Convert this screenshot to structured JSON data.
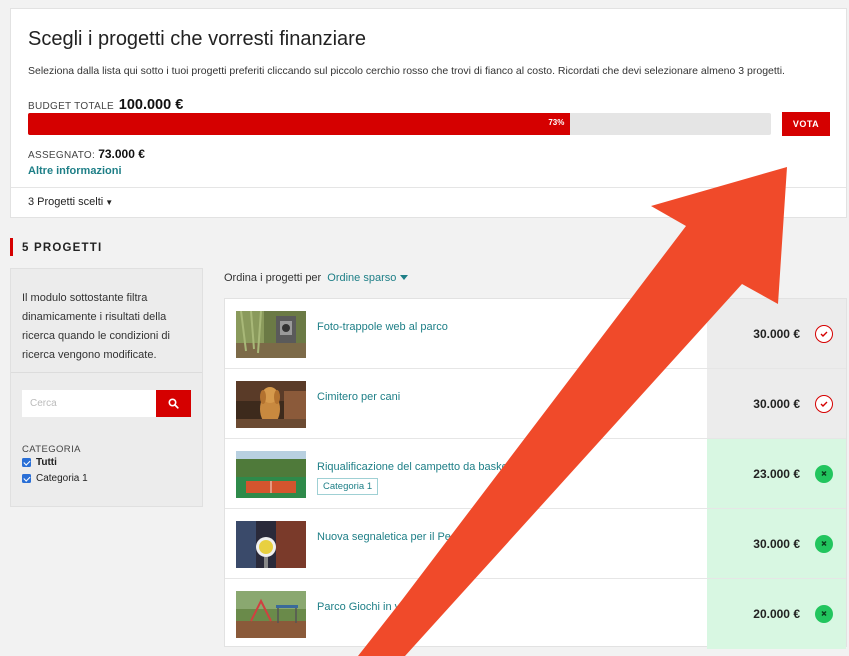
{
  "header": {
    "title": "Scegli i progetti che vorresti finanziare",
    "description": "Seleziona dalla lista qui sotto i tuoi progetti preferiti cliccando sul piccolo cerchio rosso che trovi di fianco al costo. Ricordati che devi selezionare almeno 3 progetti.",
    "budget_label": "Budget totale",
    "budget_value": "100.000 €",
    "progress_label": "73%",
    "progress_fraction": 0.73,
    "vote_button": "VOTA",
    "assigned_label": "Assegnato:",
    "assigned_value": "73.000 €",
    "more_info": "Altre informazioni",
    "chosen_count": "3 Progetti scelti"
  },
  "section": {
    "title": "5 PROGETTI"
  },
  "filter": {
    "description": "Il modulo sottostante filtra dinamicamente i risultati della ricerca quando le condizioni di ricerca vengono modificate.",
    "search_placeholder": "Cerca",
    "category_label": "CATEGORIA",
    "options": [
      "Tutti",
      "Categoria 1"
    ]
  },
  "sort": {
    "label": "Ordina i progetti per",
    "value": "Ordine sparso"
  },
  "projects": [
    {
      "title": "Foto-trappole web al parco",
      "tag": "",
      "cost": "30.000 €",
      "selected": false,
      "thumb": "forest-camera"
    },
    {
      "title": "Cimitero per cani",
      "tag": "",
      "cost": "30.000 €",
      "selected": false,
      "thumb": "dog"
    },
    {
      "title": "Riqualificazione del campetto da basket in via",
      "tag": "Categoria 1",
      "cost": "23.000 €",
      "selected": true,
      "thumb": "basket-court"
    },
    {
      "title": "Nuova segnaletica per il Pedibus",
      "tag": "",
      "cost": "30.000 €",
      "selected": true,
      "thumb": "street-sign"
    },
    {
      "title": "Parco Giochi in via Albero",
      "tag": "",
      "cost": "20.000 €",
      "selected": true,
      "thumb": "playground"
    }
  ],
  "colors": {
    "accent": "#d50000",
    "link": "#1e7f87",
    "selected_bg": "#d8f7e2",
    "selected_icon": "#22c55e",
    "arrow": "#f04a2a"
  }
}
